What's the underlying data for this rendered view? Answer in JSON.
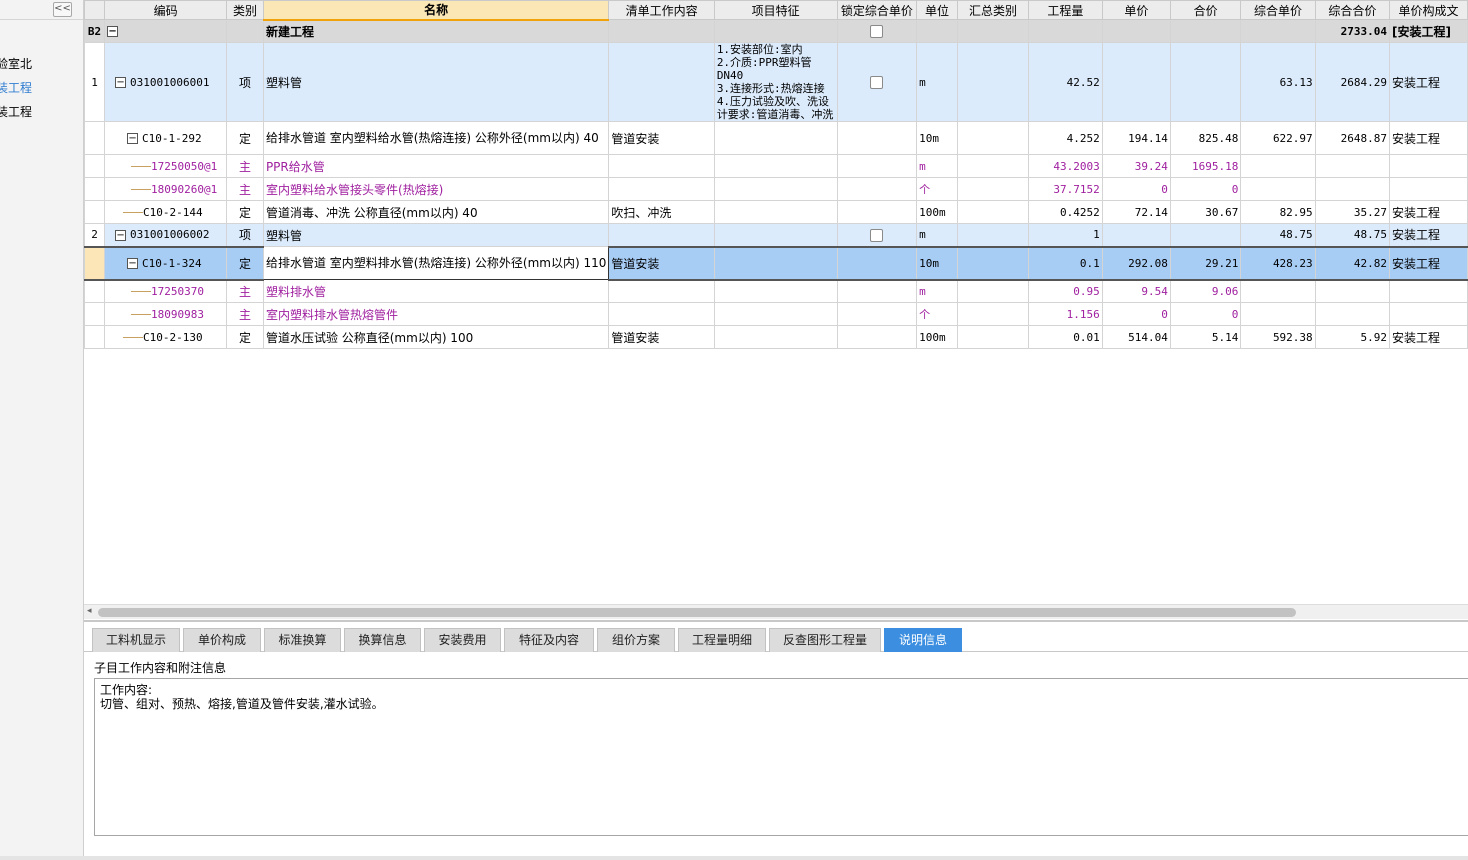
{
  "left_panel": {
    "collapse_label": "<<",
    "items": [
      {
        "label": "验室北",
        "color": "#000000"
      },
      {
        "label": "装工程",
        "color": "#2f7dd1"
      },
      {
        "label": "装工程",
        "color": "#000000"
      }
    ]
  },
  "grid": {
    "columns": {
      "code": "编码",
      "type": "类别",
      "name": "名称",
      "work": "清单工作内容",
      "feature": "项目特征",
      "lock": "锁定综合单价",
      "unit": "单位",
      "summary": "汇总类别",
      "qty": "工程量",
      "price": "单价",
      "total": "合价",
      "comp_price": "综合单价",
      "comp_total": "综合合价",
      "composition": "单价构成文"
    },
    "rows": [
      {
        "rownum": "B2",
        "code": "",
        "type": "",
        "name": "新建工程",
        "work": "",
        "feature": "",
        "unit": "",
        "summary": "",
        "qty": "",
        "price": "",
        "total": "",
        "comp_price": "",
        "comp_total": "2733.04",
        "composition": "[安装工程]"
      },
      {
        "rownum": "1",
        "code": "031001006001",
        "type": "项",
        "name": "塑料管",
        "work": "",
        "feature": "1.安装部位:室内\n2.介质:PPR塑料管DN40\n3.连接形式:热熔连接\n4.压力试验及吹、洗设计要求:管道消毒、冲洗",
        "unit": "m",
        "summary": "",
        "qty": "42.52",
        "price": "",
        "total": "",
        "comp_price": "63.13",
        "comp_total": "2684.29",
        "composition": "安装工程"
      },
      {
        "rownum": "",
        "code": "C10-1-292",
        "type": "定",
        "name": "给排水管道 室内塑料给水管(热熔连接) 公称外径(mm以内) 40",
        "work": "管道安装",
        "feature": "",
        "unit": "10m",
        "summary": "",
        "qty": "4.252",
        "price": "194.14",
        "total": "825.48",
        "comp_price": "622.97",
        "comp_total": "2648.87",
        "composition": "安装工程"
      },
      {
        "rownum": "",
        "code": "17250050@1",
        "type": "主",
        "name": "PPR给水管",
        "work": "",
        "feature": "",
        "unit": "m",
        "summary": "",
        "qty": "43.2003",
        "price": "39.24",
        "total": "1695.18",
        "comp_price": "",
        "comp_total": "",
        "composition": ""
      },
      {
        "rownum": "",
        "code": "18090260@1",
        "type": "主",
        "name": "室内塑料给水管接头零件(热熔接)",
        "work": "",
        "feature": "",
        "unit": "个",
        "summary": "",
        "qty": "37.7152",
        "price": "0",
        "total": "0",
        "comp_price": "",
        "comp_total": "",
        "composition": ""
      },
      {
        "rownum": "",
        "code": "C10-2-144",
        "type": "定",
        "name": "管道消毒、冲洗 公称直径(mm以内) 40",
        "work": "吹扫、冲洗",
        "feature": "",
        "unit": "100m",
        "summary": "",
        "qty": "0.4252",
        "price": "72.14",
        "total": "30.67",
        "comp_price": "82.95",
        "comp_total": "35.27",
        "composition": "安装工程"
      },
      {
        "rownum": "2",
        "code": "031001006002",
        "type": "项",
        "name": "塑料管",
        "work": "",
        "feature": "",
        "unit": "m",
        "summary": "",
        "qty": "1",
        "price": "",
        "total": "",
        "comp_price": "48.75",
        "comp_total": "48.75",
        "composition": "安装工程"
      },
      {
        "rownum": "",
        "code": "C10-1-324",
        "type": "定",
        "name": "给排水管道 室内塑料排水管(热熔连接) 公称外径(mm以内) 110",
        "work": "管道安装",
        "feature": "",
        "unit": "10m",
        "summary": "",
        "qty": "0.1",
        "price": "292.08",
        "total": "29.21",
        "comp_price": "428.23",
        "comp_total": "42.82",
        "composition": "安装工程"
      },
      {
        "rownum": "",
        "code": "17250370",
        "type": "主",
        "name": "塑料排水管",
        "work": "",
        "feature": "",
        "unit": "m",
        "summary": "",
        "qty": "0.95",
        "price": "9.54",
        "total": "9.06",
        "comp_price": "",
        "comp_total": "",
        "composition": ""
      },
      {
        "rownum": "",
        "code": "18090983",
        "type": "主",
        "name": "室内塑料排水管热熔管件",
        "work": "",
        "feature": "",
        "unit": "个",
        "summary": "",
        "qty": "1.156",
        "price": "0",
        "total": "0",
        "comp_price": "",
        "comp_total": "",
        "composition": ""
      },
      {
        "rownum": "",
        "code": "C10-2-130",
        "type": "定",
        "name": "管道水压试验 公称直径(mm以内) 100",
        "work": "管道安装",
        "feature": "",
        "unit": "100m",
        "summary": "",
        "qty": "0.01",
        "price": "514.04",
        "total": "5.14",
        "comp_price": "592.38",
        "comp_total": "5.92",
        "composition": "安装工程"
      }
    ]
  },
  "scrollbar": {
    "left_arrow": "◂"
  },
  "bottom": {
    "tabs": [
      "工料机显示",
      "单价构成",
      "标准换算",
      "换算信息",
      "安装费用",
      "特征及内容",
      "组价方案",
      "工程量明细",
      "反查图形工程量",
      "说明信息"
    ],
    "active_tab": "说明信息",
    "desc_label": "子目工作内容和附注信息",
    "desc_text": "工作内容:\n切管、组对、预热、熔接,管道及管件安装,灌水试验。"
  },
  "colors": {
    "main_material": "#a020a0",
    "selected_row": "#a8cdf5",
    "active_tab": "#3c8fe0",
    "qd_row": "#dcebfc"
  }
}
